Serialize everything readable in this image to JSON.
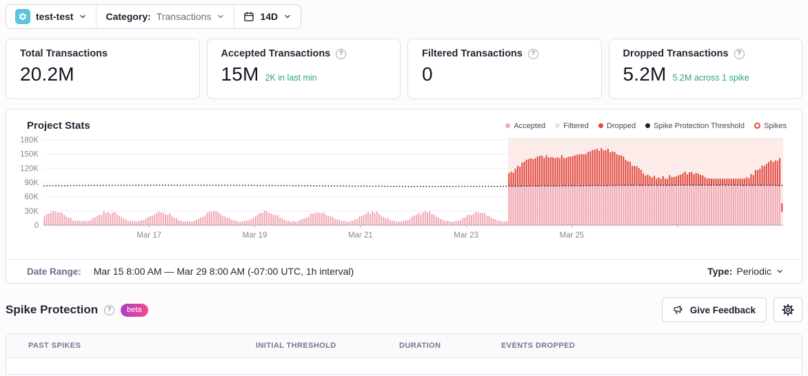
{
  "topbar": {
    "project_name": "test-test",
    "category_label": "Category:",
    "category_value": "Transactions",
    "date_range_value": "14D"
  },
  "cards": [
    {
      "label": "Total Transactions",
      "value": "20.2M",
      "sub": ""
    },
    {
      "label": "Accepted Transactions",
      "value": "15M",
      "sub": "2K in last min"
    },
    {
      "label": "Filtered Transactions",
      "value": "0",
      "sub": ""
    },
    {
      "label": "Dropped Transactions",
      "value": "5.2M",
      "sub": "5.2M across 1 spike"
    }
  ],
  "chart": {
    "title": "Project Stats",
    "legend": [
      {
        "label": "Accepted",
        "color": "#f1a8b6",
        "marker": "dot"
      },
      {
        "label": "Filtered",
        "color": "#f8dce3",
        "marker": "dot"
      },
      {
        "label": "Dropped",
        "color": "#e2483f",
        "marker": "dot"
      },
      {
        "label": "Spike Protection Threshold",
        "color": "#231a2e",
        "marker": "dot"
      },
      {
        "label": "Spikes",
        "color": "#e2483f",
        "marker": "ring"
      }
    ]
  },
  "chart_data": {
    "type": "bar",
    "stacked": true,
    "x_start": "Mar 15 8:00 AM",
    "x_end": "Mar 29 8:00 AM",
    "interval": "1h",
    "n_bars": 336,
    "ylim": [
      0,
      180000
    ],
    "yticks": [
      {
        "label": "180K",
        "value_k": 180
      },
      {
        "label": "150K",
        "value_k": 150
      },
      {
        "label": "120K",
        "value_k": 120
      },
      {
        "label": "90K",
        "value_k": 90
      },
      {
        "label": "60K",
        "value_k": 60
      },
      {
        "label": "30K",
        "value_k": 30
      },
      {
        "label": "0",
        "value_k": 0
      }
    ],
    "xtick_labels": [
      {
        "day": 2,
        "label": "Mar 17"
      },
      {
        "day": 4,
        "label": "Mar 19"
      },
      {
        "day": 6,
        "label": "Mar 21"
      },
      {
        "day": 8,
        "label": "Mar 23"
      },
      {
        "day": 10,
        "label": "Mar 25"
      }
    ],
    "tick_marks_days": [
      2,
      4,
      6,
      8,
      10,
      12
    ],
    "series": [
      {
        "name": "Accepted",
        "color": "#f1a8b6"
      },
      {
        "name": "Filtered",
        "color": "#f8dce3"
      },
      {
        "name": "Dropped",
        "color": "#e2483f"
      }
    ],
    "threshold": {
      "name": "Spike Protection Threshold",
      "value_k": 83,
      "color": "#231a2e",
      "style": "dotted"
    },
    "pre_spike_accepted_range_k": [
      7,
      31
    ],
    "daily_pattern": "sinusoidal daily cycle, peaks ~28-31K midday, troughs ~9-12K",
    "spike_region": {
      "start_hour": 211,
      "end_hour": 335,
      "background": "#fcebe9",
      "accepted_clipped_at_threshold_k": 83,
      "dropped_total_range_k": [
        98,
        166
      ]
    },
    "last_partial_bar_k": {
      "from": 28,
      "to": 46,
      "series": "Dropped"
    },
    "grid": true,
    "legend_position": "top-right"
  },
  "footer": {
    "date_range_label": "Date Range:",
    "date_range_value": "Mar 15 8:00 AM — Mar 29 8:00 AM (-07:00 UTC, 1h interval)",
    "type_label": "Type:",
    "type_value": "Periodic"
  },
  "spike_section": {
    "title": "Spike Protection",
    "badge": "beta",
    "feedback_button": "Give Feedback"
  },
  "table": {
    "headers": [
      "PAST SPIKES",
      "INITIAL THRESHOLD",
      "DURATION",
      "EVENTS DROPPED"
    ]
  },
  "colors": {
    "accent_teal": "#2ba185",
    "dropped_red": "#e2483f",
    "accepted_pink": "#f1a8b6",
    "spike_background": "#fcebe9",
    "threshold_dark": "#231a2e",
    "badge_gradient": [
      "#b03dc6",
      "#f54a8f"
    ],
    "project_icon_bg": "#5cc4dd"
  }
}
